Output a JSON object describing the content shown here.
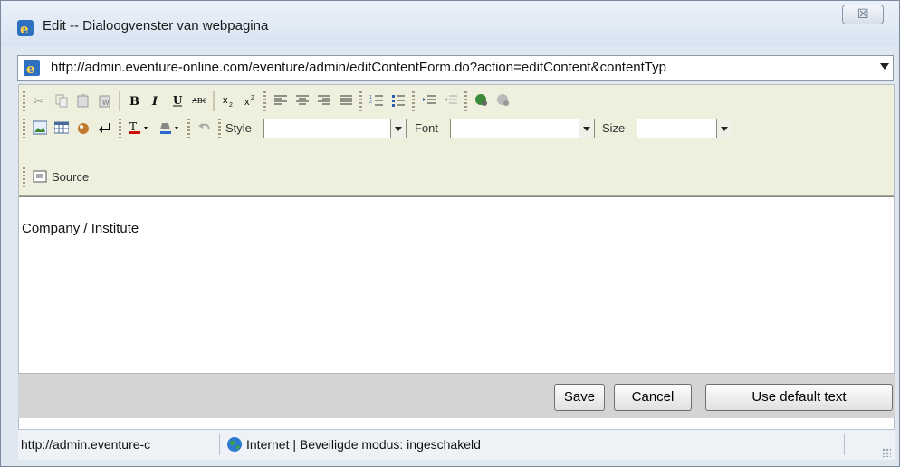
{
  "window": {
    "title": "Edit -- Dialoogvenster van webpagina",
    "close_glyph": "☒"
  },
  "address": {
    "url": "http://admin.eventure-online.com/eventure/admin/editContentForm.do?action=editContent&contentTyp"
  },
  "toolbar": {
    "style_label": "Style",
    "font_label": "Font",
    "size_label": "Size",
    "source_label": "Source",
    "icons_row1": [
      "cut-icon",
      "copy-icon",
      "paste-icon",
      "paste-word-icon",
      "bold-icon",
      "italic-icon",
      "underline-icon",
      "strikethrough-icon",
      "subscript-icon",
      "superscript-icon",
      "align-left-icon",
      "align-center-icon",
      "align-right-icon",
      "justify-icon",
      "ordered-list-icon",
      "unordered-list-icon",
      "indent-icon",
      "outdent-icon",
      "link-icon",
      "unlink-icon"
    ],
    "icons_row2": [
      "image-icon",
      "table-icon",
      "special-char-icon",
      "line-break-icon",
      "text-color-icon",
      "background-color-icon",
      "undo-icon"
    ]
  },
  "editor": {
    "content": "Company / Institute"
  },
  "buttons": {
    "save": "Save",
    "cancel": "Cancel",
    "default": "Use default text"
  },
  "status": {
    "url": "http://admin.eventure-c",
    "zone": "Internet | Beveiligde modus: ingeschakeld"
  },
  "colors": {
    "toolbar_bg": "#efefde",
    "window_bg": "#dfe7f1",
    "button_bar": "#d4d4d4"
  }
}
